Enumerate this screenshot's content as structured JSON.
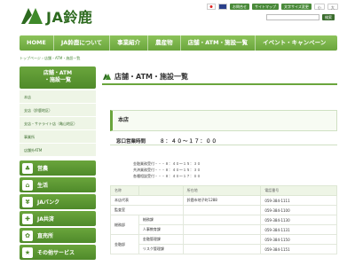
{
  "header": {
    "logo_text": "JA鈴鹿",
    "top_links": [
      "お問合せ",
      "サイトマップ",
      "文字サイズ変更",
      "小",
      "大"
    ],
    "search_placeholder": "",
    "search_button": "検索"
  },
  "nav": [
    "HOME",
    "JA鈴鹿について",
    "事業紹介",
    "農産物",
    "店舗・ATM・施設一覧",
    "イベント・キャンペーン"
  ],
  "breadcrumb": "トップページ › 店舗・ATM・施設一覧",
  "sidebar": {
    "heading_line1": "店舗・ATM",
    "heading_line2": "・施設一覧",
    "items": [
      "本店",
      "支店（鈴鹿地区）",
      "支店・サテライト店（亀山地区）",
      "事業所",
      "店舗外ATM"
    ],
    "services": [
      {
        "label": "営農",
        "icon": "farming-icon",
        "glyph": "♣"
      },
      {
        "label": "生活",
        "icon": "life-icon",
        "glyph": "⌂"
      },
      {
        "label": "JAバンク",
        "icon": "bank-icon",
        "glyph": "¥"
      },
      {
        "label": "JA共済",
        "icon": "insurance-icon",
        "glyph": "✚"
      },
      {
        "label": "直売所",
        "icon": "shop-icon",
        "glyph": "✿"
      },
      {
        "label": "その他サービス",
        "icon": "service-icon",
        "glyph": "★"
      }
    ]
  },
  "main": {
    "title": "店舗・ATM・施設一覧",
    "store_name": "本店",
    "hours_label": "窓口営業時間",
    "hours_value": "８：４０～１７：００",
    "hours_detail": "金融業務受付・・・８：４０～１５：３０\n共済業務受付・・・８：４０～１５：３０\n各種相談受付・・・８：４０～１７：００",
    "table": {
      "headers": [
        "名称",
        "",
        "所在地",
        "電話番号"
      ],
      "rows": [
        [
          "本店代表",
          "",
          "鈴鹿市地子町1288",
          "059-384-1111"
        ],
        [
          "監査室",
          "",
          "",
          "059-384-1100"
        ],
        [
          "総務部",
          "総務課",
          "",
          "059-384-1130"
        ],
        [
          "",
          "人事教育課",
          "",
          "059-384-1131"
        ],
        [
          "金融部",
          "金融管理課",
          "",
          "059-384-1150"
        ],
        [
          "",
          "リスク管理課",
          "",
          "059-384-1151"
        ]
      ]
    }
  },
  "colors": {
    "brand_green": "#4f8a2a",
    "nav_green": "#8cc35a",
    "light_green": "#eef5e6"
  }
}
